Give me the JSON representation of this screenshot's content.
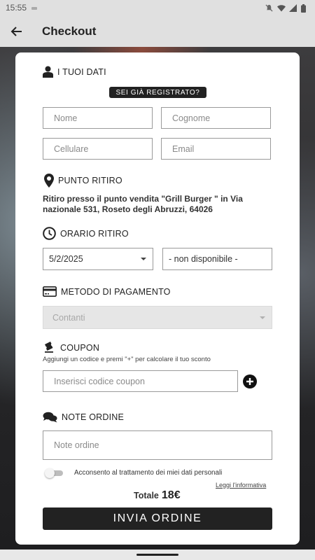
{
  "status_bar": {
    "time": "15:55"
  },
  "app_bar": {
    "title": "Checkout"
  },
  "personal": {
    "heading": "I TUOI DATI",
    "registered_label": "SEI GIÀ REGISTRATO?",
    "first_name_placeholder": "Nome",
    "last_name_placeholder": "Cognome",
    "phone_placeholder": "Cellulare",
    "email_placeholder": "Email"
  },
  "pickup": {
    "heading": "PUNTO RITIRO",
    "address": "Ritiro presso il punto vendita \"Grill Burger \" in Via nazionale 531, Roseto degli Abruzzi, 64026"
  },
  "pickup_time": {
    "heading": "ORARIO RITIRO",
    "date_value": "5/2/2025",
    "time_value": "- non disponibile -"
  },
  "payment": {
    "heading": "METODO DI PAGAMENTO",
    "selected": "Contanti"
  },
  "coupon": {
    "heading": "COUPON",
    "hint": "Aggiungi un codice e premi \"+\" per calcolare il tuo sconto",
    "placeholder": "Inserisci codice coupon"
  },
  "notes": {
    "heading": "NOTE ORDINE",
    "placeholder": "Note ordine"
  },
  "consent": {
    "label": "Acconsento al trattamento dei miei dati personali",
    "checked": false,
    "privacy_link": "Leggi l'informativa"
  },
  "total": {
    "label": "Totale",
    "value": "18€"
  },
  "submit_label": "INVIA ORDINE",
  "colors": {
    "accent": "#222222",
    "app_bar": "#e0e0e0"
  }
}
